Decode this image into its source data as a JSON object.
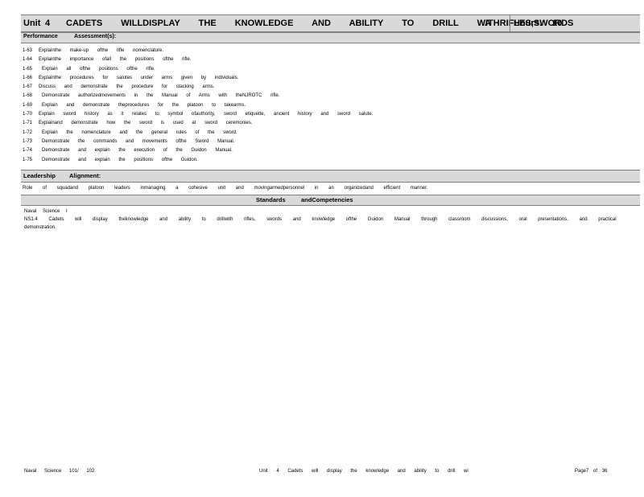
{
  "header": {
    "unit_label": "Unit",
    "unit_number": "4",
    "unit_title": "CADETS WILLDISPLAY THE KNOWLEDGE AND ABILITY TO DRILL WITHRIFLES,SWORDS",
    "unit_title_suffix": "A",
    "hours_label": "Hours:",
    "hours_value": "10"
  },
  "performance_bar": {
    "performance_label": "Performance",
    "assessment_label": "Assessment(s):"
  },
  "objectives": [
    {
      "code": "1-63",
      "text": "Explainthe make-up ofthe rifle nomenclature."
    },
    {
      "code": "1-64",
      "text": "Explainthe importance ofall the positions ofthe rifle."
    },
    {
      "code": "1-65",
      "text": "Explain all ofthe positions ofthe rifle."
    },
    {
      "code": "1-66",
      "text": "Explainthe procedures for salutes under arms given by individuals."
    },
    {
      "code": "1-67",
      "text": "Discuss and demonstrate the procedure for stacking arms."
    },
    {
      "code": "1-68",
      "text": "Demonstrate authorizedmovements in the Manual of Arms with theNJROTC rifle."
    },
    {
      "code": "1-69",
      "text": "Explain and demonstrate theprocedures for the platoon to takearms."
    },
    {
      "code": "1-70",
      "text": "Explain sword history as it relates to symbol ofauthority, sword etiquette, ancient history and sword salute."
    },
    {
      "code": "1-71",
      "text": "Explainand demonstrate how the sword is used at sword ceremonies."
    },
    {
      "code": "1-72",
      "text": "Explain the nomenclature and the general rules of the sword."
    },
    {
      "code": "1-73",
      "text": "Demonstrate the commands and movements ofthe Sword Manual."
    },
    {
      "code": "1-74",
      "text": "Demonstrate and explain the execution of the Guidon Manual."
    },
    {
      "code": "1-75",
      "text": "Demonstrate and explain the positions ofthe Guidon."
    }
  ],
  "leadership_bar": {
    "leadership_label": "Leadership",
    "alignment_label": "Alignment:"
  },
  "alignment_text": "Role of squadand platoon leaders inmanaging a cohesive unit and movingarmedpersonnel in an organizedand efficient manner.",
  "standards_bar": {
    "standards_label": "Standards",
    "competencies_label": "andCompetencies"
  },
  "standards": {
    "category": "Naval Science I",
    "statement": "NS1.4 Cadets will display theknowledge and ability to drillwith rifles, swords and knowledge ofthe Guidon Manual through classroom discussions, oral presentations, and practical demonstration."
  },
  "footer": {
    "left": "Naval Science 101/ 102",
    "center": "Unit 4 Cadets will display the knowledge and ability to drill wi",
    "right": "Page7 of 36"
  }
}
